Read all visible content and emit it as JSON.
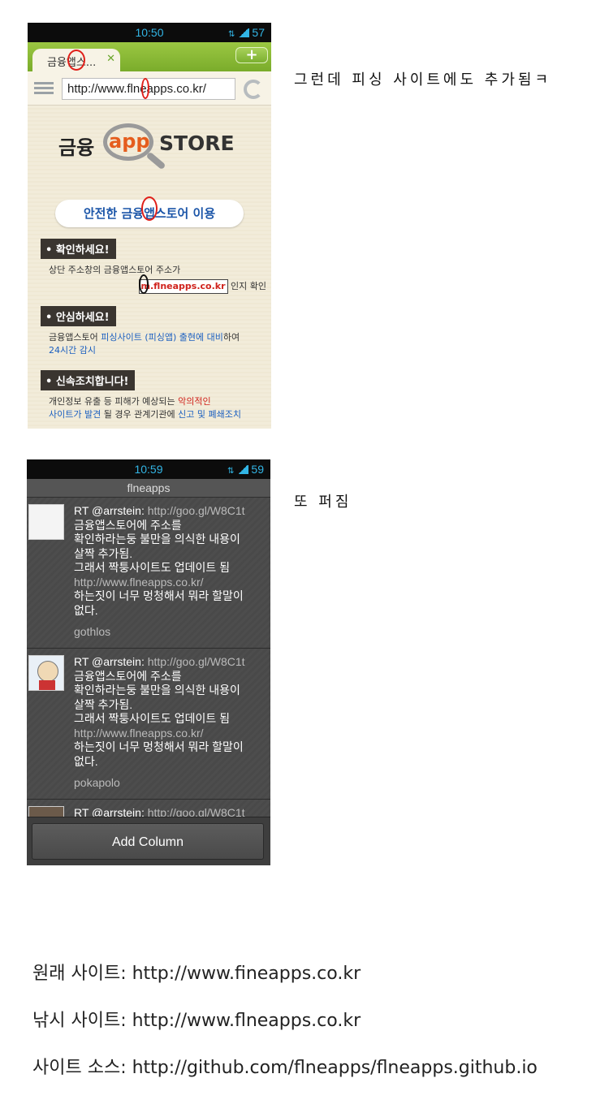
{
  "phone1": {
    "status_time": "10:50",
    "status_battery": "57",
    "tab_title": "금융앱스...",
    "new_tab_symbol": "+",
    "url": "http://www.flneapps.co.kr/",
    "logo": {
      "prefix": "금융",
      "app": "app",
      "store": "STORE"
    },
    "safe_button": "안전한 금융앱스토어 이용",
    "sections": [
      {
        "title": "• 확인하세요!",
        "line1": "상단 주소창의 금융앱스토어 주소가",
        "url_box": "m.flneapps.co.kr",
        "line2_suffix": " 인지 확인"
      },
      {
        "title": "• 안심하세요!",
        "part1": "금융앱스토어 ",
        "part2": "피싱사이트 (피싱앱) 출현에 대비",
        "part3": "하여",
        "part4": "24시간 감시"
      },
      {
        "title": "• 신속조치합니다!",
        "part1": "개인정보 유출 등 피해가 예상되는 ",
        "part2": "악의적인",
        "part3": "사이트가 발견",
        "part4": " 될 경우 관계기관에 ",
        "part5": "신고 및 폐쇄조치"
      }
    ]
  },
  "caption1": "그런데 피싱 사이트에도 추가됨ㅋ",
  "phone2": {
    "status_time": "10:59",
    "status_battery": "59",
    "column_title": "flneapps",
    "tweets": [
      {
        "rt": "RT @arrstein: ",
        "link1": "http://goo.gl/W8C1t",
        "l1": "금융앱스토어에 주소를",
        "l2": "확인하라는둥 불만을 의식한 내용이",
        "l3": "살짝 추가됨.",
        "l4": "그래서 짝퉁사이트도 업데이트 됨",
        "link2": "http://www.flneapps.co.kr/",
        "l5": "하는짓이 너무 멍청해서 뭐라 할말이",
        "l6": "없다.",
        "user": "gothlos"
      },
      {
        "rt": "RT @arrstein: ",
        "link1": "http://goo.gl/W8C1t",
        "l1": "금융앱스토어에 주소를",
        "l2": "확인하라는둥 불만을 의식한 내용이",
        "l3": "살짝 추가됨.",
        "l4": "그래서 짝퉁사이트도 업데이트 됨",
        "link2": "http://www.flneapps.co.kr/",
        "l5": "하는짓이 너무 멍청해서 뭐라 할말이",
        "l6": "없다.",
        "user": "pokapolo"
      },
      {
        "rt": "RT @arrstein: ",
        "link1": "http://goo.gl/W8C1t"
      }
    ],
    "add_column": "Add Column"
  },
  "caption2": "또 퍼짐",
  "footer": {
    "original_label": "원래 사이트: ",
    "original_pre": "http://www.f",
    "original_hl": "i",
    "original_post": "neapps.co.kr",
    "phishing_label": "낚시 사이트: ",
    "phishing_pre": "http://www.f",
    "phishing_hl": "l",
    "phishing_post": "neapps.co.kr",
    "source_label": "사이트 소스: ",
    "source_url": "http://github.com/flneapps/flneapps.github.io"
  },
  "colors": {
    "android_blue": "#32b5e5",
    "tab_green": "#8fbf3b",
    "link_blue": "#1b5fc0",
    "warn_red": "#d0231d"
  }
}
